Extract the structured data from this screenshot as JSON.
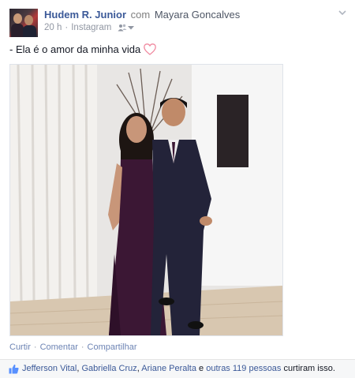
{
  "post": {
    "author": "Hudem R. Junior",
    "with_label": "com",
    "tagged": "Mayara Goncalves",
    "time": "20 h",
    "separator": "·",
    "source": "Instagram",
    "privacy_icon": "friends-icon",
    "text": "- Ela é o amor da minha vida",
    "emoji": "heart-icon"
  },
  "actions": {
    "like": "Curtir",
    "comment": "Comentar",
    "share": "Compartilhar",
    "dot": "·"
  },
  "likes": {
    "names": [
      "Jefferson Vital",
      "Gabriella Cruz",
      "Ariane Peralta"
    ],
    "comma": ",",
    "and_others_prefix": "e",
    "others": "outras 119 pessoas",
    "suffix": "curtiram isso."
  },
  "colors": {
    "link": "#3b5998",
    "muted": "#9197a3",
    "action": "#6d84b4",
    "heart": "#f4a6b5"
  }
}
